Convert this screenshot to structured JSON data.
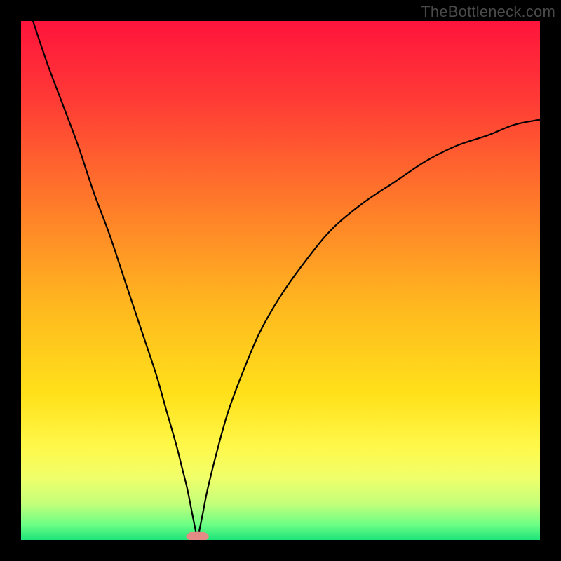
{
  "watermark": "TheBottleneck.com",
  "colors": {
    "frame": "#000000",
    "curve": "#000000",
    "marker": "#e48b86",
    "gradient_stops": [
      {
        "offset": 0.0,
        "color": "#ff143c"
      },
      {
        "offset": 0.15,
        "color": "#ff3a36"
      },
      {
        "offset": 0.35,
        "color": "#ff7a2a"
      },
      {
        "offset": 0.55,
        "color": "#ffb81f"
      },
      {
        "offset": 0.72,
        "color": "#ffe11a"
      },
      {
        "offset": 0.82,
        "color": "#fff84a"
      },
      {
        "offset": 0.88,
        "color": "#f0ff6a"
      },
      {
        "offset": 0.93,
        "color": "#c4ff7a"
      },
      {
        "offset": 0.97,
        "color": "#6dff85"
      },
      {
        "offset": 1.0,
        "color": "#1de47a"
      }
    ]
  },
  "chart_data": {
    "type": "line",
    "title": "",
    "xlabel": "",
    "ylabel": "",
    "xlim": [
      0,
      100
    ],
    "ylim": [
      0,
      100
    ],
    "minimum": {
      "x": 34,
      "y": 0
    },
    "marker": {
      "x_center": 34,
      "rx": 2.2,
      "ry": 1.0
    },
    "series": [
      {
        "name": "curve",
        "x": [
          0,
          2,
          5,
          8,
          11,
          14,
          17,
          20,
          23,
          26,
          28,
          30,
          31,
          32,
          33,
          33.6,
          34,
          34.4,
          35,
          36,
          38,
          40,
          43,
          46,
          50,
          55,
          60,
          66,
          72,
          78,
          84,
          90,
          95,
          100
        ],
        "y": [
          108,
          101,
          92,
          84,
          76,
          67,
          59,
          50,
          41,
          32,
          25,
          18,
          14,
          10,
          5,
          2,
          0,
          2,
          5,
          10,
          18,
          25,
          33,
          40,
          47,
          54,
          60,
          65,
          69,
          73,
          76,
          78,
          80,
          81
        ]
      }
    ]
  }
}
